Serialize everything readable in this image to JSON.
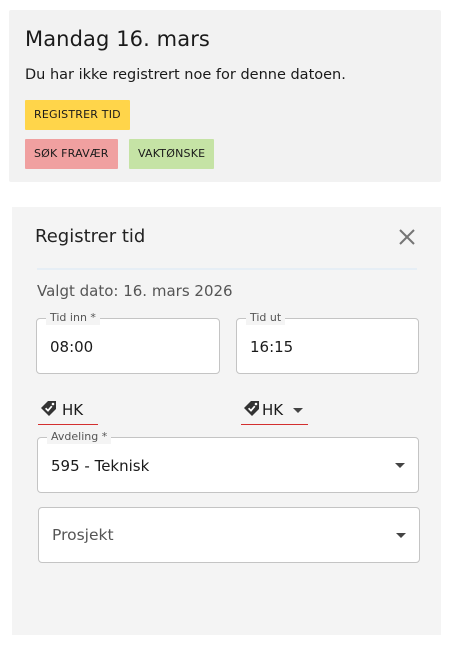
{
  "day": {
    "title": "Mandag 16. mars",
    "message": "Du har ikke registrert noe for denne datoen.",
    "buttons": {
      "register": "REGISTRER TID",
      "absence": "SØK FRAVÆR",
      "shift": "VAKTØNSKE"
    }
  },
  "dialog": {
    "title": "Registrer tid",
    "selected_date": "Valgt dato: 16. mars 2026",
    "time_in": {
      "label": "Tid inn *",
      "value": "08:00"
    },
    "time_out": {
      "label": "Tid ut",
      "value": "16:15"
    },
    "tag_in": {
      "value": "HK",
      "icon": "tag-check-icon"
    },
    "tag_out": {
      "value": "HK",
      "icon": "tag-check-icon"
    },
    "department": {
      "label": "Avdeling *",
      "value": "595 - Teknisk"
    },
    "project": {
      "placeholder": "Prosjekt"
    }
  },
  "colors": {
    "register_button": "#ffd54a",
    "absence_button": "#f0a0a0",
    "shift_button": "#c5e3a5",
    "underline_error": "#d32f2f",
    "panel_bg": "#f2f2f2"
  }
}
